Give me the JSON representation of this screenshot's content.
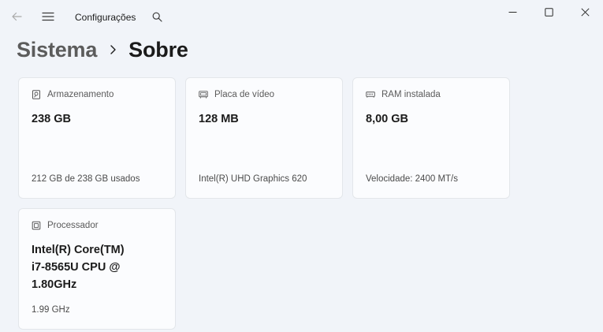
{
  "titlebar": {
    "app_title": "Configurações",
    "back_icon": "arrow-left-icon",
    "menu_icon": "hamburger-menu-icon",
    "search_icon": "search-icon",
    "window_controls": [
      "minimize-icon",
      "maximize-icon",
      "close-icon"
    ]
  },
  "breadcrumb": {
    "parent": "Sistema",
    "current": "Sobre"
  },
  "cards": [
    {
      "id": "storage",
      "icon": "storage-drive-icon",
      "label": "Armazenamento",
      "value": "238 GB",
      "detail": "212 GB de 238 GB usados"
    },
    {
      "id": "gpu",
      "icon": "display-adapter-icon",
      "label": "Placa de vídeo",
      "value": "128 MB",
      "detail": "Intel(R) UHD Graphics 620"
    },
    {
      "id": "ram",
      "icon": "memory-icon",
      "label": "RAM instalada",
      "value": "8,00 GB",
      "detail": "Velocidade: 2400 MT/s"
    },
    {
      "id": "cpu",
      "icon": "processor-icon",
      "label": "Processador",
      "value_lines": [
        "Intel(R) Core(TM)",
        "i7-8565U CPU @",
        "1.80GHz"
      ],
      "detail": "1.99 GHz"
    }
  ],
  "colors": {
    "background": "#f1f4f9",
    "card": "#fbfcfe",
    "card_border": "#e3e6ea",
    "text_primary": "#1b1b1b",
    "text_secondary": "#5a5a5a"
  }
}
